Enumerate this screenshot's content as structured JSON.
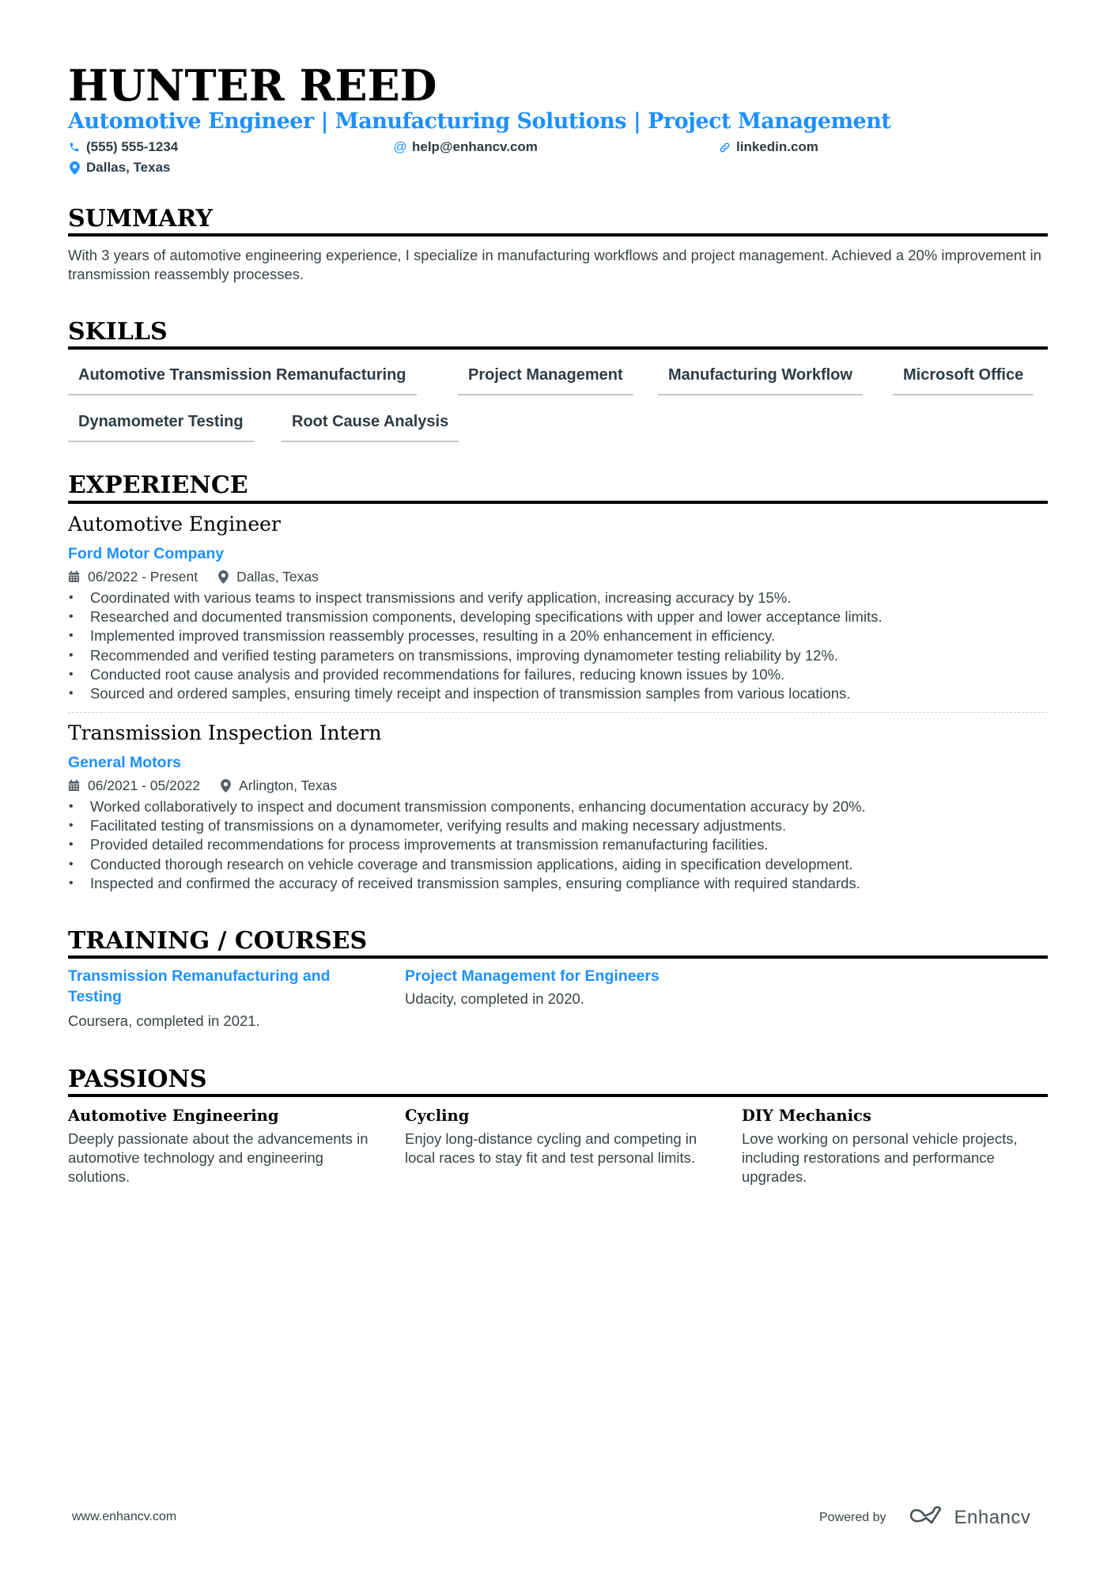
{
  "header": {
    "name": "HUNTER REED",
    "headline": "Automotive Engineer | Manufacturing Solutions | Project Management",
    "contacts": {
      "phone": {
        "icon": "phone-icon",
        "text": "(555) 555-1234"
      },
      "email": {
        "icon": "at-icon",
        "text": "help@enhancv.com"
      },
      "link": {
        "icon": "link-icon",
        "text": "linkedin.com"
      },
      "location": {
        "icon": "location-pin-icon",
        "text": "Dallas, Texas"
      }
    }
  },
  "colors": {
    "accent": "#1e90ff",
    "text": "#384347",
    "heading": "#000000"
  },
  "summary": {
    "title": "SUMMARY",
    "text": "With 3 years of automotive engineering experience, I specialize in manufacturing workflows and project management. Achieved a 20% improvement in transmission reassembly processes."
  },
  "skills": {
    "title": "SKILLS",
    "items": [
      "Automotive Transmission Remanufacturing",
      "Project Management",
      "Manufacturing Workflow",
      "Microsoft Office",
      "Dynamometer Testing",
      "Root Cause Analysis"
    ]
  },
  "experience": {
    "title": "EXPERIENCE",
    "jobs": [
      {
        "role": "Automotive Engineer",
        "company": "Ford Motor Company",
        "dates": "06/2022 - Present",
        "location": "Dallas, Texas",
        "bullets": [
          "Coordinated with various teams to inspect transmissions and verify application, increasing accuracy by 15%.",
          "Researched and documented transmission components, developing specifications with upper and lower acceptance limits.",
          "Implemented improved transmission reassembly processes, resulting in a 20% enhancement in efficiency.",
          "Recommended and verified testing parameters on transmissions, improving dynamometer testing reliability by 12%.",
          "Conducted root cause analysis and provided recommendations for failures, reducing known issues by 10%.",
          "Sourced and ordered samples, ensuring timely receipt and inspection of transmission samples from various locations."
        ]
      },
      {
        "role": "Transmission Inspection Intern",
        "company": "General Motors",
        "dates": "06/2021 - 05/2022",
        "location": "Arlington, Texas",
        "bullets": [
          "Worked collaboratively to inspect and document transmission components, enhancing documentation accuracy by 20%.",
          "Facilitated testing of transmissions on a dynamometer, verifying results and making necessary adjustments.",
          "Provided detailed recommendations for process improvements at transmission remanufacturing facilities.",
          "Conducted thorough research on vehicle coverage and transmission applications, aiding in specification development.",
          "Inspected and confirmed the accuracy of received transmission samples, ensuring compliance with required standards."
        ]
      }
    ]
  },
  "training": {
    "title": "TRAINING / COURSES",
    "items": [
      {
        "title": "Transmission Remanufacturing and Testing",
        "desc": "Coursera, completed in 2021."
      },
      {
        "title": "Project Management for Engineers",
        "desc": "Udacity, completed in 2020."
      }
    ]
  },
  "passions": {
    "title": "PASSIONS",
    "items": [
      {
        "title": "Automotive Engineering",
        "desc": "Deeply passionate about the advancements in automotive technology and engineering solutions."
      },
      {
        "title": "Cycling",
        "desc": "Enjoy long-distance cycling and competing in local races to stay fit and test personal limits."
      },
      {
        "title": "DIY Mechanics",
        "desc": "Love working on personal vehicle projects, including restorations and performance upgrades."
      }
    ]
  },
  "footer": {
    "website": "www.enhancv.com",
    "powered_by": "Powered by",
    "brand": "Enhancv"
  }
}
